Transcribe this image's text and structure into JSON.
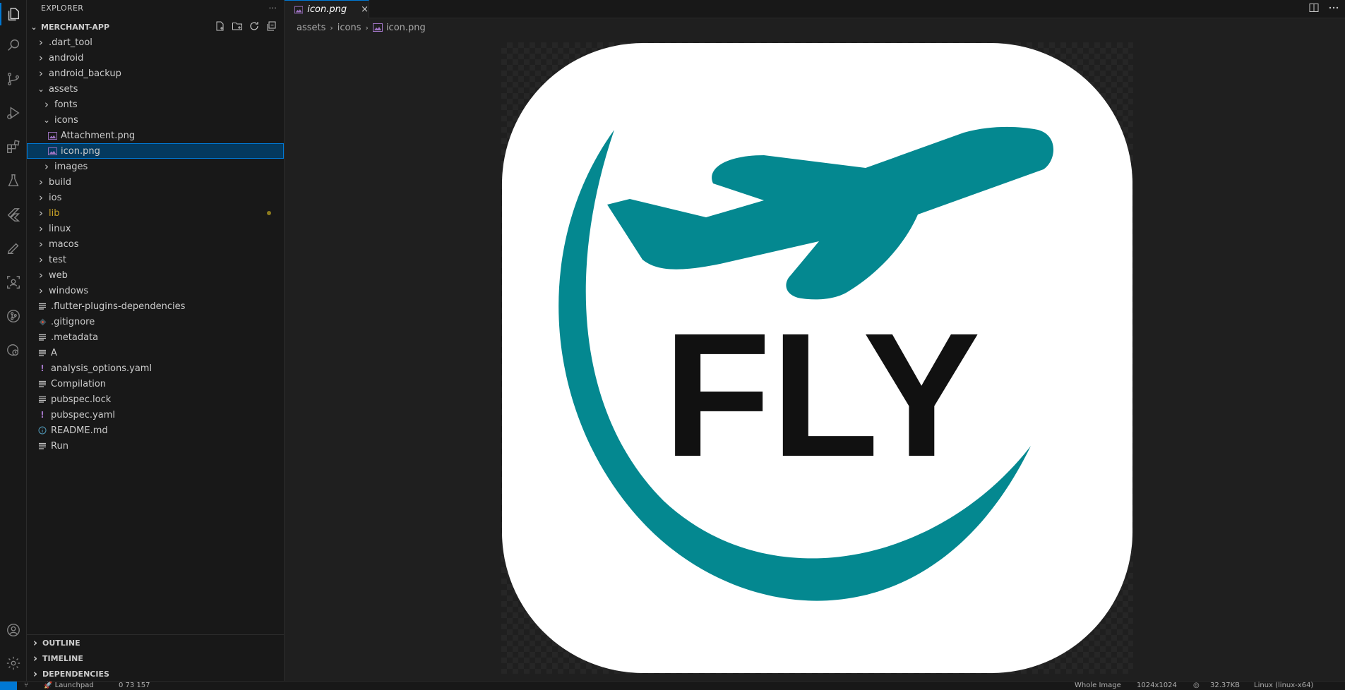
{
  "sidebar": {
    "title": "EXPLORER",
    "more": "···",
    "project": "MERCHANT-APP",
    "tree": [
      {
        "label": ".dart_tool",
        "type": "folder",
        "depth": 0
      },
      {
        "label": "android",
        "type": "folder",
        "depth": 0
      },
      {
        "label": "android_backup",
        "type": "folder",
        "depth": 0
      },
      {
        "label": "assets",
        "type": "folder-open",
        "depth": 0
      },
      {
        "label": "fonts",
        "type": "folder",
        "depth": 1
      },
      {
        "label": "icons",
        "type": "folder-open",
        "depth": 1
      },
      {
        "label": "Attachment.png",
        "type": "image",
        "depth": 2
      },
      {
        "label": "icon.png",
        "type": "image",
        "depth": 2,
        "selected": true
      },
      {
        "label": "images",
        "type": "folder",
        "depth": 1
      },
      {
        "label": "build",
        "type": "folder",
        "depth": 0
      },
      {
        "label": "ios",
        "type": "folder",
        "depth": 0
      },
      {
        "label": "lib",
        "type": "folder",
        "depth": 0,
        "modified": true
      },
      {
        "label": "linux",
        "type": "folder",
        "depth": 0
      },
      {
        "label": "macos",
        "type": "folder",
        "depth": 0
      },
      {
        "label": "test",
        "type": "folder",
        "depth": 0
      },
      {
        "label": "web",
        "type": "folder",
        "depth": 0
      },
      {
        "label": "windows",
        "type": "folder",
        "depth": 0
      },
      {
        "label": ".flutter-plugins-dependencies",
        "type": "lines",
        "depth": 0
      },
      {
        "label": ".gitignore",
        "type": "git",
        "depth": 0
      },
      {
        "label": ".metadata",
        "type": "lines",
        "depth": 0
      },
      {
        "label": "A",
        "type": "lines",
        "depth": 0
      },
      {
        "label": "analysis_options.yaml",
        "type": "yaml",
        "depth": 0
      },
      {
        "label": "Compilation",
        "type": "lines",
        "depth": 0
      },
      {
        "label": "pubspec.lock",
        "type": "lines",
        "depth": 0
      },
      {
        "label": "pubspec.yaml",
        "type": "yaml",
        "depth": 0
      },
      {
        "label": "README.md",
        "type": "info",
        "depth": 0
      },
      {
        "label": "Run",
        "type": "lines",
        "depth": 0
      }
    ],
    "sections": [
      "OUTLINE",
      "TIMELINE",
      "DEPENDENCIES"
    ]
  },
  "editor": {
    "tab_label": "icon.png",
    "tab_close": "×",
    "breadcrumb": [
      "assets",
      "icons",
      "icon.png"
    ],
    "image_text": "FLY",
    "colors": {
      "plane": "#048890",
      "text": "#111111",
      "card": "#ffffff",
      "accent": "#0078d4"
    }
  },
  "statusbar": {
    "launchpad": "Launchpad",
    "problems": "0  73  157",
    "zoom": "Whole Image",
    "dimensions": "1024x1024",
    "size": "32.37KB",
    "platform": "Linux (linux-x64)"
  }
}
